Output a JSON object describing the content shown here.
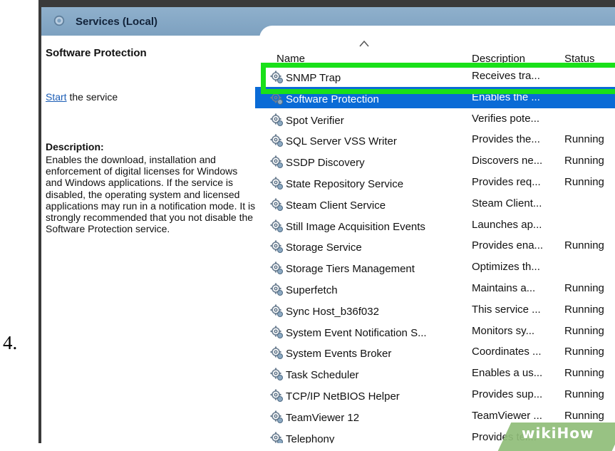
{
  "step_number": "4.",
  "window": {
    "title": "Services (Local)"
  },
  "left_pane": {
    "title": "Software Protection",
    "start_link": "Start",
    "start_suffix": " the service",
    "description_label": "Description:",
    "description_text": "Enables the download, installation and enforcement of digital licenses for Windows and Windows applications. If the service is disabled, the operating system and licensed applications may run in a notification mode. It is strongly recommended that you not disable the Software Protection service."
  },
  "columns": {
    "name": "Name",
    "description": "Description",
    "status": "Status"
  },
  "rows": [
    {
      "name": "SNMP Trap",
      "description": "Receives tra...",
      "status": ""
    },
    {
      "name": "Software Protection",
      "description": "Enables the ...",
      "status": "",
      "selected": true
    },
    {
      "name": "Spot Verifier",
      "description": "Verifies pote...",
      "status": ""
    },
    {
      "name": "SQL Server VSS Writer",
      "description": "Provides the...",
      "status": "Running"
    },
    {
      "name": "SSDP Discovery",
      "description": "Discovers ne...",
      "status": "Running"
    },
    {
      "name": "State Repository Service",
      "description": "Provides req...",
      "status": "Running"
    },
    {
      "name": "Steam Client Service",
      "description": "Steam Client...",
      "status": ""
    },
    {
      "name": "Still Image Acquisition Events",
      "description": "Launches ap...",
      "status": ""
    },
    {
      "name": "Storage Service",
      "description": "Provides ena...",
      "status": "Running"
    },
    {
      "name": "Storage Tiers Management",
      "description": "Optimizes th...",
      "status": ""
    },
    {
      "name": "Superfetch",
      "description": "Maintains a...",
      "status": "Running"
    },
    {
      "name": "Sync Host_b36f032",
      "description": "This service ...",
      "status": "Running"
    },
    {
      "name": "System Event Notification S...",
      "description": "Monitors sy...",
      "status": "Running"
    },
    {
      "name": "System Events Broker",
      "description": "Coordinates ...",
      "status": "Running"
    },
    {
      "name": "Task Scheduler",
      "description": "Enables a us...",
      "status": "Running"
    },
    {
      "name": "TCP/IP NetBIOS Helper",
      "description": "Provides sup...",
      "status": "Running"
    },
    {
      "name": "TeamViewer 12",
      "description": "TeamViewer ...",
      "status": "Running"
    },
    {
      "name": "Telephony",
      "description": "Provides tel...",
      "status": ""
    }
  ],
  "watermark": "wikiHow",
  "colors": {
    "selection": "#0a6bd6",
    "highlight": "#19e019",
    "link": "#1d5eb6"
  }
}
